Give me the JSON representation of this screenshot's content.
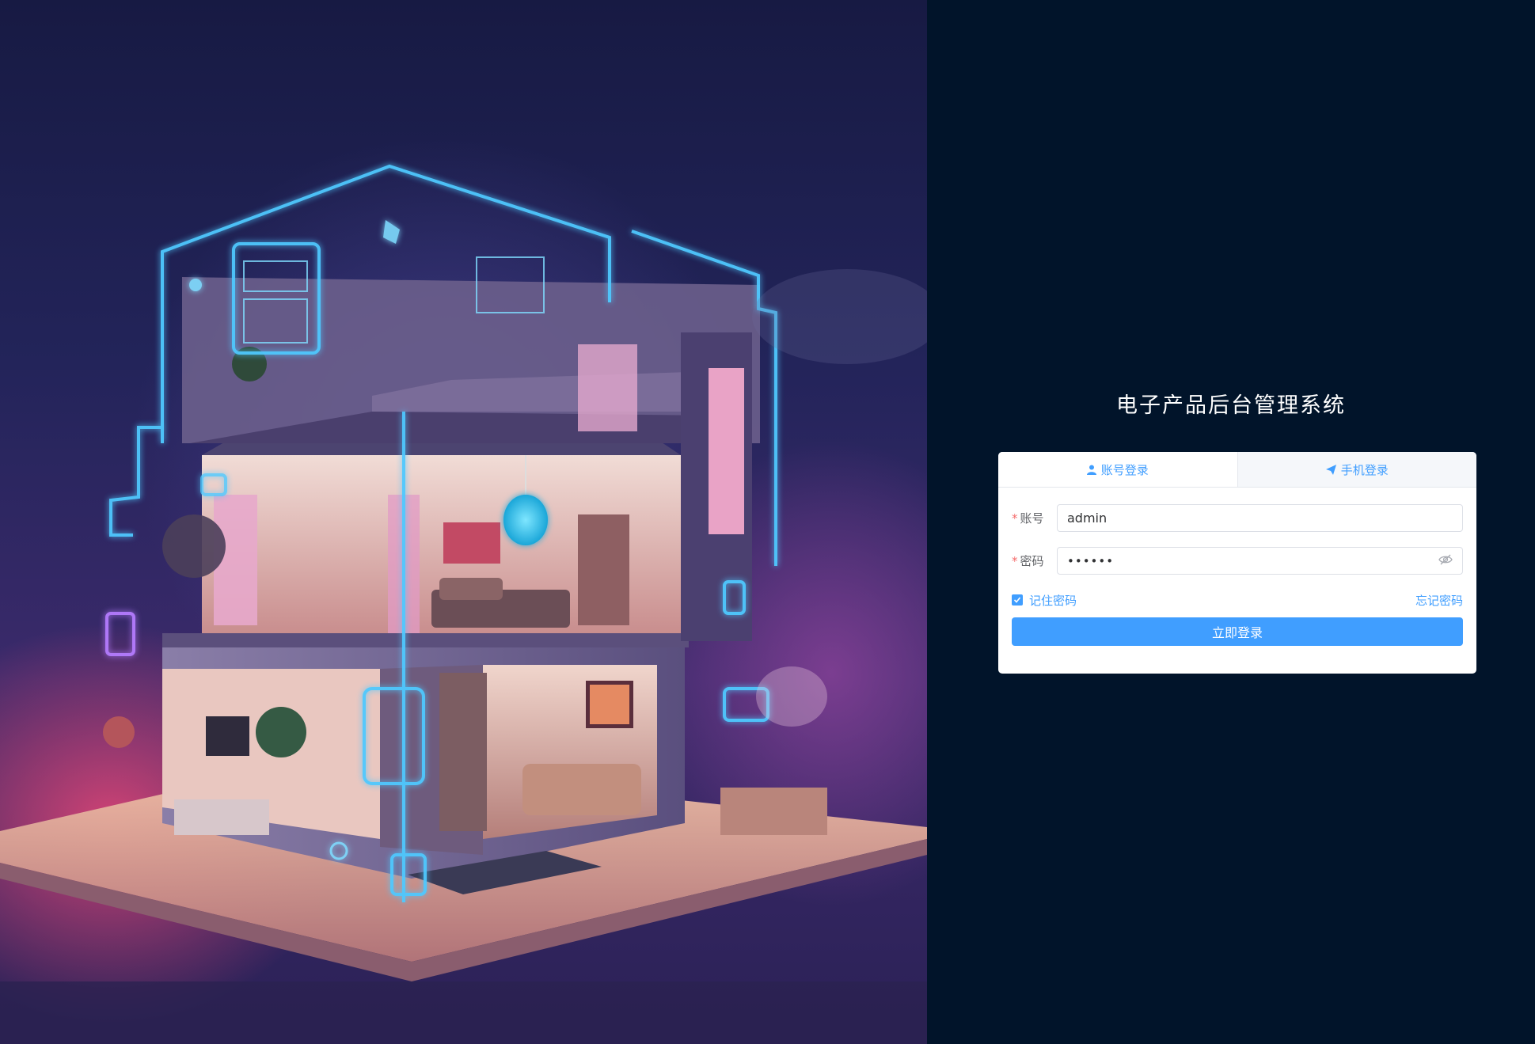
{
  "app": {
    "title": "电子产品后台管理系统"
  },
  "colors": {
    "background": "#01142a",
    "accent": "#409eff",
    "required": "#f56c6c"
  },
  "login": {
    "tabs": [
      {
        "label": "账号登录",
        "icon": "user-icon",
        "active": true
      },
      {
        "label": "手机登录",
        "icon": "paper-plane-icon",
        "active": false
      }
    ],
    "account_label": "账号",
    "account_value": "admin",
    "password_label": "密码",
    "password_value": "••••••",
    "required_mark": "*",
    "remember_label": "记住密码",
    "remember_checked": true,
    "forgot_label": "忘记密码",
    "submit_label": "立即登录"
  },
  "hero": {
    "image": "smart-home-illustration"
  }
}
